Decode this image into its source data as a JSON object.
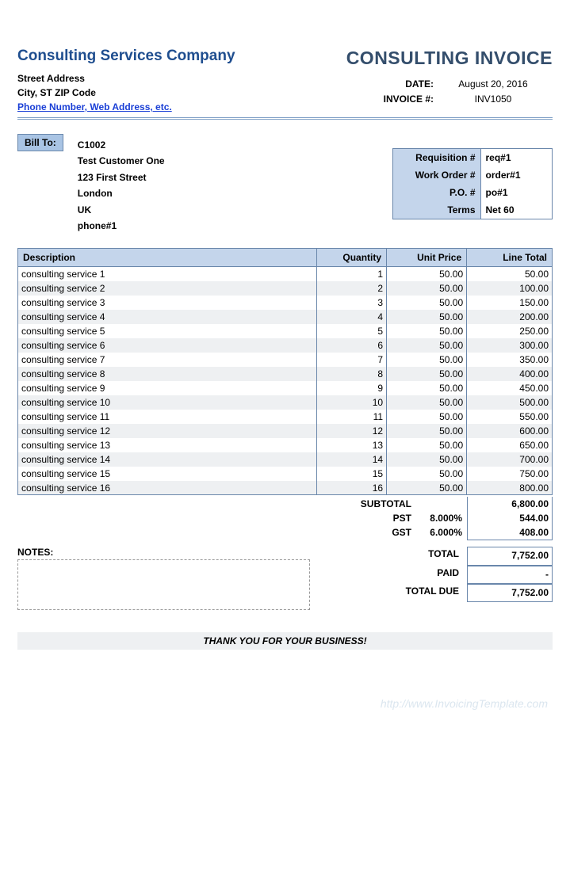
{
  "company": {
    "name": "Consulting Services Company",
    "street": "Street Address",
    "city_line": "City, ST  ZIP Code",
    "contact_link": "Phone Number, Web Address, etc."
  },
  "doc_title": "CONSULTING INVOICE",
  "meta": {
    "date_label": "DATE:",
    "date_value": "August 20, 2016",
    "invoice_label": "INVOICE #:",
    "invoice_value": "INV1050"
  },
  "billto_label": "Bill To:",
  "bill": {
    "code": "C1002",
    "name": "Test Customer One",
    "street": "123 First Street",
    "city": "London",
    "country": "UK",
    "phone": "phone#1"
  },
  "order": {
    "req_label": "Requisition #",
    "req_value": "req#1",
    "wo_label": "Work Order #",
    "wo_value": "order#1",
    "po_label": "P.O. #",
    "po_value": "po#1",
    "terms_label": "Terms",
    "terms_value": "Net 60"
  },
  "columns": {
    "desc": "Description",
    "qty": "Quantity",
    "price": "Unit Price",
    "total": "Line Total"
  },
  "items": [
    {
      "desc": "consulting service 1",
      "qty": "1",
      "price": "50.00",
      "total": "50.00"
    },
    {
      "desc": "consulting service 2",
      "qty": "2",
      "price": "50.00",
      "total": "100.00"
    },
    {
      "desc": "consulting service 3",
      "qty": "3",
      "price": "50.00",
      "total": "150.00"
    },
    {
      "desc": "consulting service 4",
      "qty": "4",
      "price": "50.00",
      "total": "200.00"
    },
    {
      "desc": "consulting service  5",
      "qty": "5",
      "price": "50.00",
      "total": "250.00"
    },
    {
      "desc": "consulting service 6",
      "qty": "6",
      "price": "50.00",
      "total": "300.00"
    },
    {
      "desc": "consulting service 7",
      "qty": "7",
      "price": "50.00",
      "total": "350.00"
    },
    {
      "desc": "consulting service 8",
      "qty": "8",
      "price": "50.00",
      "total": "400.00"
    },
    {
      "desc": "consulting service 9",
      "qty": "9",
      "price": "50.00",
      "total": "450.00"
    },
    {
      "desc": "consulting service 10",
      "qty": "10",
      "price": "50.00",
      "total": "500.00"
    },
    {
      "desc": "consulting service 11",
      "qty": "11",
      "price": "50.00",
      "total": "550.00"
    },
    {
      "desc": "consulting service 12",
      "qty": "12",
      "price": "50.00",
      "total": "600.00"
    },
    {
      "desc": "consulting service 13",
      "qty": "13",
      "price": "50.00",
      "total": "650.00"
    },
    {
      "desc": "consulting service 14",
      "qty": "14",
      "price": "50.00",
      "total": "700.00"
    },
    {
      "desc": "consulting service 15",
      "qty": "15",
      "price": "50.00",
      "total": "750.00"
    },
    {
      "desc": "consulting service 16",
      "qty": "16",
      "price": "50.00",
      "total": "800.00"
    }
  ],
  "subtotal": {
    "label": "SUBTOTAL",
    "value": "6,800.00",
    "pst_label": "PST",
    "pst_pct": "8.000%",
    "pst_value": "544.00",
    "gst_label": "GST",
    "gst_pct": "6.000%",
    "gst_value": "408.00"
  },
  "notes_label": "NOTES:",
  "totals": {
    "total_label": "TOTAL",
    "total_value": "7,752.00",
    "paid_label": "PAID",
    "paid_value": "-",
    "due_label": "TOTAL DUE",
    "due_value": "7,752.00"
  },
  "thank_you": "THANK YOU FOR YOUR BUSINESS!",
  "watermark": "http://www.InvoicingTemplate.com"
}
